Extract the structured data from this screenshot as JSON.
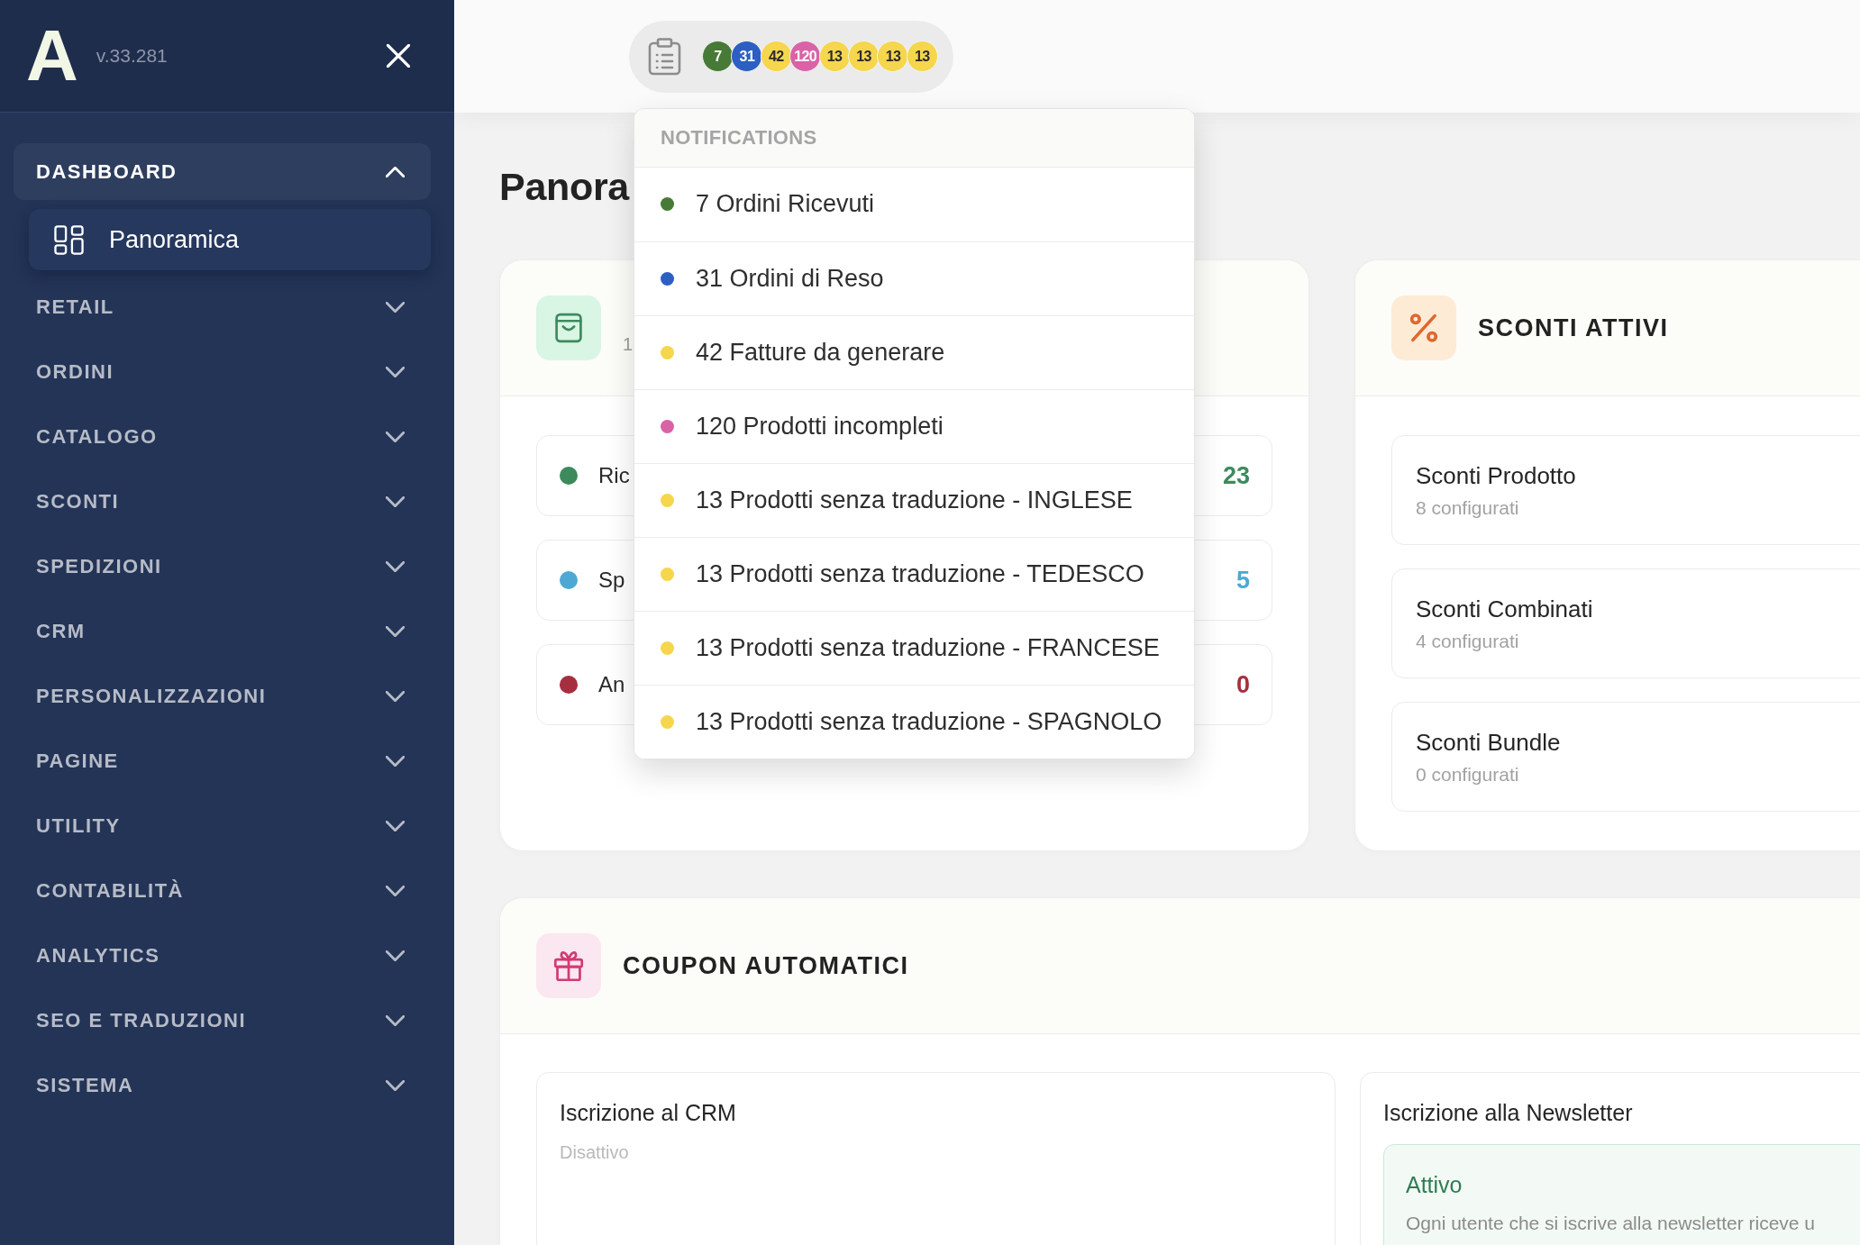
{
  "sidebar": {
    "logo": "A",
    "version": "v.33.281",
    "groups": [
      {
        "label": "DASHBOARD",
        "expanded": true,
        "children": [
          {
            "label": "Panoramica",
            "selected": true
          }
        ]
      },
      {
        "label": "RETAIL",
        "expanded": false
      },
      {
        "label": "ORDINI",
        "expanded": false
      },
      {
        "label": "CATALOGO",
        "expanded": false
      },
      {
        "label": "SCONTI",
        "expanded": false
      },
      {
        "label": "SPEDIZIONI",
        "expanded": false
      },
      {
        "label": "CRM",
        "expanded": false
      },
      {
        "label": "PERSONALIZZAZIONI",
        "expanded": false
      },
      {
        "label": "PAGINE",
        "expanded": false
      },
      {
        "label": "UTILITY",
        "expanded": false
      },
      {
        "label": "CONTABILITÀ",
        "expanded": false
      },
      {
        "label": "ANALYTICS",
        "expanded": false
      },
      {
        "label": "SEO E TRADUZIONI",
        "expanded": false
      },
      {
        "label": "SISTEMA",
        "expanded": false
      }
    ]
  },
  "topbar": {
    "badges": [
      {
        "count": "7",
        "color": "#467a36"
      },
      {
        "count": "31",
        "color": "#2d5fc2"
      },
      {
        "count": "42",
        "color": "#f5d64d"
      },
      {
        "count": "120",
        "color": "#d963a6"
      },
      {
        "count": "13",
        "color": "#f5d64d"
      },
      {
        "count": "13",
        "color": "#f5d64d"
      },
      {
        "count": "13",
        "color": "#f5d64d"
      },
      {
        "count": "13",
        "color": "#f5d64d"
      }
    ]
  },
  "notifications": {
    "title": "NOTIFICATIONS",
    "items": [
      {
        "text": "7 Ordini Ricevuti",
        "color": "#467a36"
      },
      {
        "text": "31 Ordini di Reso",
        "color": "#2d5fc2"
      },
      {
        "text": "42 Fatture da generare",
        "color": "#f5d64d"
      },
      {
        "text": "120 Prodotti incompleti",
        "color": "#d963a6"
      },
      {
        "text": "13 Prodotti senza traduzione - INGLESE",
        "color": "#f5d64d"
      },
      {
        "text": "13 Prodotti senza traduzione - TEDESCO",
        "color": "#f5d64d"
      },
      {
        "text": "13 Prodotti senza traduzione - FRANCESE",
        "color": "#f5d64d"
      },
      {
        "text": "13 Prodotti senza traduzione - SPAGNOLO",
        "color": "#f5d64d"
      }
    ]
  },
  "page": {
    "title": "Panora"
  },
  "cards": [
    {
      "kind": "status",
      "subtitle": "1",
      "rows": [
        {
          "label": "Ric",
          "value": "23",
          "color": "#3d8a5c"
        },
        {
          "label": "Sp",
          "value": "5",
          "color": "#4ea8d3"
        },
        {
          "label": "An",
          "value": "0",
          "color": "#a52f3f"
        }
      ]
    },
    {
      "kind": "list",
      "title": "SCONTI ATTIVI",
      "items": [
        {
          "name": "Sconti Prodotto",
          "detail": "8 configurati"
        },
        {
          "name": "Sconti Combinati",
          "detail": "4 configurati"
        },
        {
          "name": "Sconti Bundle",
          "detail": "0 configurati"
        }
      ]
    }
  ],
  "coupons": {
    "title": "COUPON AUTOMATICI",
    "items": [
      {
        "name": "Iscrizione al CRM",
        "active": false,
        "status": "Disattivo"
      },
      {
        "name": "Iscrizione alla Newsletter",
        "active": true,
        "status": "Attivo",
        "description": "Ogni utente che si iscrive alla newsletter riceve u"
      }
    ]
  }
}
